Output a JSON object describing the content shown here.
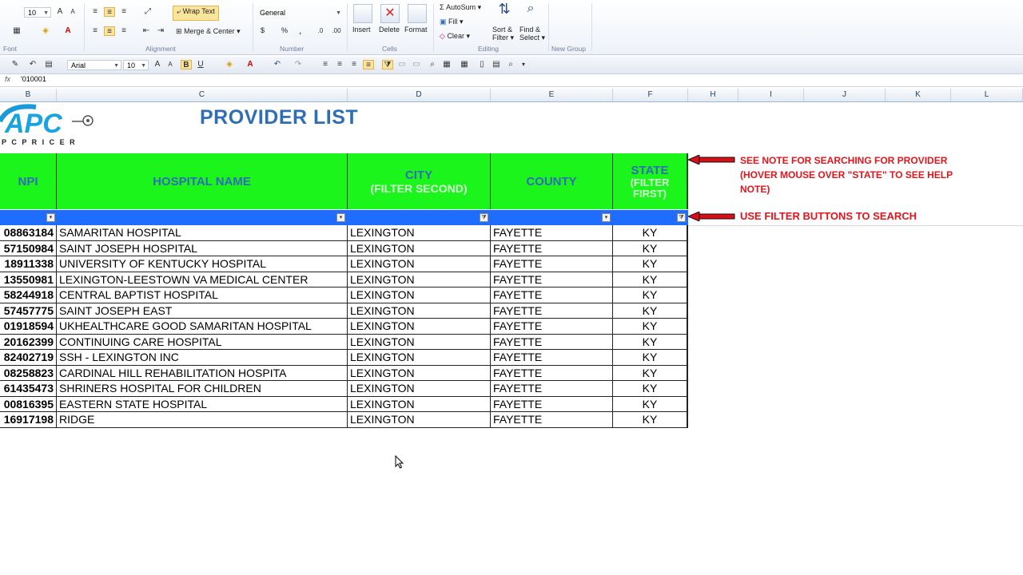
{
  "ribbon": {
    "font_size": "10",
    "wrap_text": "Wrap Text",
    "merge_center": "Merge & Center",
    "number_format": "General",
    "currency": "$",
    "percent": "%",
    "comma": ",",
    "insert": "Insert",
    "delete": "Delete",
    "format": "Format",
    "autosum": "AutoSum",
    "fill": "Fill",
    "clear": "Clear",
    "sort_filter_1": "Sort &",
    "sort_filter_2": "Filter",
    "find_select_1": "Find &",
    "find_select_2": "Select",
    "groups": [
      "Font",
      "Alignment",
      "Number",
      "Cells",
      "Editing",
      "New Group"
    ]
  },
  "minibar": {
    "font_name": "Arial",
    "font_size": "10"
  },
  "formula_bar": {
    "fx": "fx",
    "content": "'010001"
  },
  "columns": [
    "B",
    "C",
    "D",
    "E",
    "F",
    "H",
    "I",
    "J",
    "K",
    "L"
  ],
  "logo": {
    "text": "APC",
    "subtitle": "P C   P R I C E R"
  },
  "sheet_title": "PROVIDER LIST",
  "headers": {
    "npi": "NPI",
    "hospital": "HOSPITAL NAME",
    "city": "CITY",
    "city_sub": "(FILTER SECOND)",
    "county": "COUNTY",
    "state": "STATE",
    "state_sub_1": "(FILTER",
    "state_sub_2": "FIRST)"
  },
  "notes": {
    "note1_line1": "SEE NOTE FOR SEARCHING FOR PROVIDER",
    "note1_line2": "(HOVER MOUSE OVER \"STATE\" TO SEE HELP",
    "note1_line3": "NOTE)",
    "note2": "USE FILTER BUTTONS TO SEARCH"
  },
  "colors": {
    "header_green": "#1bf51b",
    "filter_blue": "#1e6dff",
    "title_blue": "#2f6db5",
    "note_red": "#e3141b"
  },
  "rows": [
    {
      "npi": "08863184",
      "name": "SAMARITAN HOSPITAL",
      "city": "LEXINGTON",
      "county": "FAYETTE",
      "state": "KY"
    },
    {
      "npi": "57150984",
      "name": "SAINT JOSEPH HOSPITAL",
      "city": "LEXINGTON",
      "county": "FAYETTE",
      "state": "KY"
    },
    {
      "npi": "18911338",
      "name": "UNIVERSITY OF KENTUCKY HOSPITAL",
      "city": "LEXINGTON",
      "county": "FAYETTE",
      "state": "KY"
    },
    {
      "npi": "13550981",
      "name": "LEXINGTON-LEESTOWN VA MEDICAL CENTER",
      "city": "LEXINGTON",
      "county": "FAYETTE",
      "state": "KY"
    },
    {
      "npi": "58244918",
      "name": "CENTRAL BAPTIST HOSPITAL",
      "city": "LEXINGTON",
      "county": "FAYETTE",
      "state": "KY"
    },
    {
      "npi": "57457775",
      "name": "SAINT JOSEPH EAST",
      "city": "LEXINGTON",
      "county": "FAYETTE",
      "state": "KY"
    },
    {
      "npi": "01918594",
      "name": "UKHEALTHCARE GOOD SAMARITAN HOSPITAL",
      "city": "LEXINGTON",
      "county": "FAYETTE",
      "state": "KY"
    },
    {
      "npi": "20162399",
      "name": "CONTINUING CARE HOSPITAL",
      "city": "LEXINGTON",
      "county": "FAYETTE",
      "state": "KY"
    },
    {
      "npi": "82402719",
      "name": "SSH - LEXINGTON  INC",
      "city": "LEXINGTON",
      "county": "FAYETTE",
      "state": "KY"
    },
    {
      "npi": "08258823",
      "name": "CARDINAL HILL REHABILITATION HOSPITA",
      "city": "LEXINGTON",
      "county": "FAYETTE",
      "state": "KY"
    },
    {
      "npi": "61435473",
      "name": "SHRINERS HOSPITAL FOR CHILDREN",
      "city": "LEXINGTON",
      "county": "FAYETTE",
      "state": "KY"
    },
    {
      "npi": "00816395",
      "name": "EASTERN STATE HOSPITAL",
      "city": "LEXINGTON",
      "county": "FAYETTE",
      "state": "KY"
    },
    {
      "npi": "16917198",
      "name": "RIDGE",
      "city": "LEXINGTON",
      "county": "FAYETTE",
      "state": "KY"
    }
  ]
}
